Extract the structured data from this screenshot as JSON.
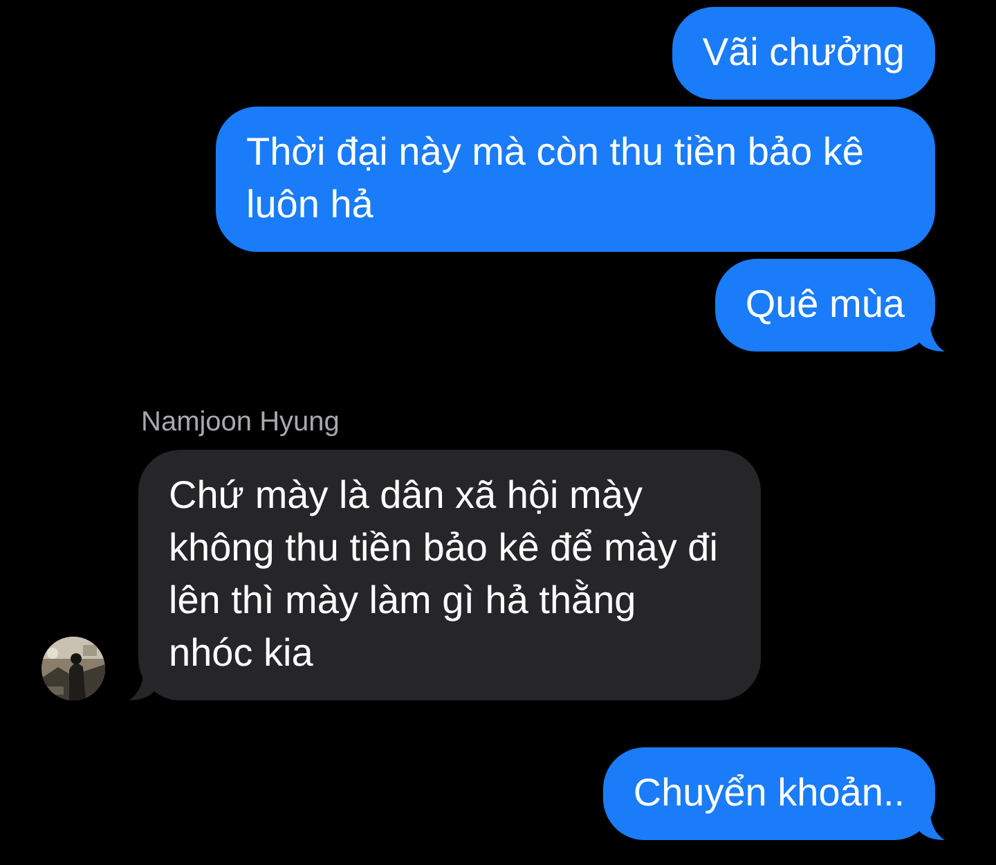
{
  "messages": [
    {
      "kind": "outgoing",
      "text": "Vãi chưởng",
      "tail": false
    },
    {
      "kind": "outgoing",
      "text": "Thời đại này mà còn thu tiền bảo kê luôn hả",
      "tail": false
    },
    {
      "kind": "outgoing",
      "text": "Quê mùa",
      "tail": true
    },
    {
      "kind": "incoming",
      "sender": "Namjoon Hyung",
      "text": "Chứ mày là dân xã hội mày không thu tiền bảo kê để mày đi lên thì mày làm gì hả thằng nhóc kia",
      "tail": true
    },
    {
      "kind": "outgoing",
      "text": "Chuyển khoản..",
      "tail": true
    }
  ]
}
